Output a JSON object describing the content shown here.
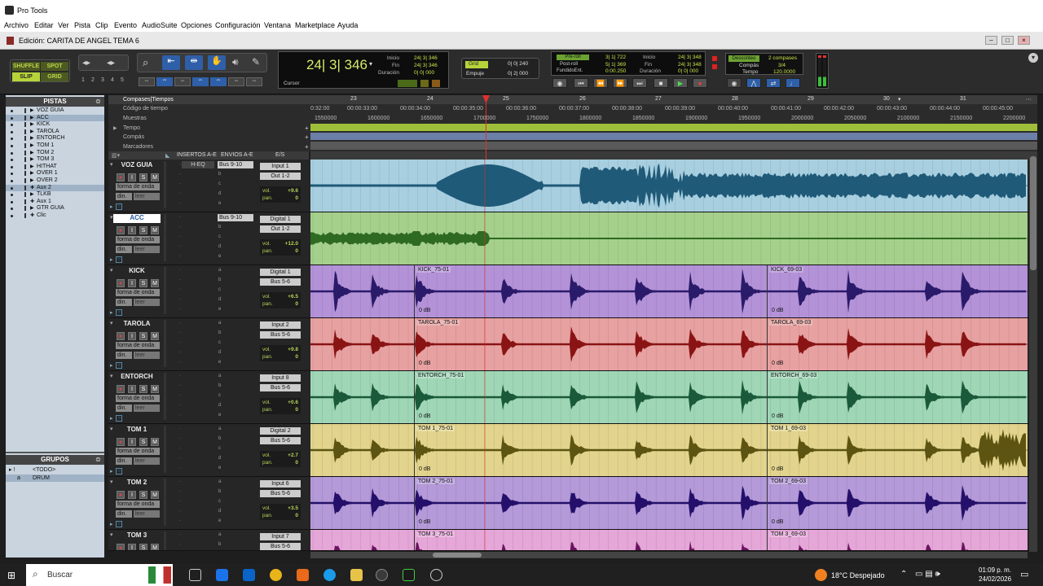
{
  "window": {
    "app_title": "Pro Tools",
    "doc_title": "Edición: CARITA DE ANGEL TEMA 6"
  },
  "menu": [
    "Archivo",
    "Editar",
    "Ver",
    "Pista",
    "Clip",
    "Evento",
    "AudioSuite",
    "Opciones",
    "Configuración",
    "Ventana",
    "Marketplace",
    "Ayuda"
  ],
  "toolbar": {
    "modes": [
      "SHUFFLE",
      "SPOT",
      "SLIP",
      "GRID"
    ],
    "zoom_presets": [
      "1",
      "2",
      "3",
      "4",
      "5"
    ],
    "main_counter": "24| 3| 346",
    "counter_labels": {
      "start": "Inicio",
      "end": "Fin",
      "length": "Duración",
      "cursor": "Cursor"
    },
    "counter_values": {
      "start": "24| 3| 346",
      "end": "24| 3| 346",
      "length": "0| 0| 000"
    },
    "grid_label": "Grid",
    "grid_value": "0| 0| 240",
    "nudge_label": "Empuje",
    "nudge_value": "0| 2| 000",
    "preroll_label": "Pre-roll",
    "postroll_label": "Post-roll",
    "fadein_label": "FundidoEnt.",
    "preroll_value": "3| 1| 722",
    "postroll_value": "5| 1| 369",
    "fadein_value": "0:00.250",
    "t_start_label": "Inicio",
    "t_end_label": "Fin",
    "t_len_label": "Duración",
    "t_start": "24| 3| 348",
    "t_end": "24| 3| 348",
    "t_len": "0| 0| 000",
    "countoff_label": "Desconteo",
    "countoff_value": "2 compases",
    "meter_label": "Compás",
    "meter_value": "3/4",
    "tempo_label": "Tempo",
    "tempo_value": "120.0000"
  },
  "left_panel": {
    "tracks_header": "PISTAS",
    "tracks": [
      "VOZ GUIA",
      "ACC",
      "KICK",
      "TAROLA",
      "ENTORCH",
      "TOM 1",
      "TOM 2",
      "TOM 3",
      "HITHAT",
      "OVER 1",
      "OVER 2",
      "Aux 2",
      "TLKB",
      "Aux 1",
      "GTR GUIA",
      "Clic"
    ],
    "groups_header": "GRUPOS",
    "groups": [
      "<TODO>",
      "DRUM"
    ]
  },
  "ruler": {
    "rows": [
      "Compases|Tiempos",
      "Código de tiempo",
      "Muestras",
      "Tempo",
      "Compás",
      "Marcadores"
    ],
    "bars": [
      "23",
      "24",
      "25",
      "26",
      "27",
      "28",
      "29",
      "30",
      "31"
    ],
    "timecodes": [
      "0:32:00",
      "00:00:33:00",
      "00:00:34:00",
      "00:00:35:00",
      "00:00:36:00",
      "00:00:37:00",
      "00:00:38:00",
      "00:00:39:00",
      "00:00:40:00",
      "00:00:41:00",
      "00:00:42:00",
      "00:00:43:00",
      "00:00:44:00",
      "00:00:45:00"
    ],
    "samples": [
      "1550000",
      "1600000",
      "1650000",
      "1700000",
      "1750000",
      "1800000",
      "1850000",
      "1900000",
      "1950000",
      "2000000",
      "2050000",
      "2100000",
      "2150000",
      "2200000"
    ]
  },
  "columns": {
    "inserts": "INSERTOS A-E",
    "sends": "ENVIOS A-E",
    "io": "E/S"
  },
  "track_labels": {
    "waveform": "forma de onda",
    "dyn": "din.",
    "read": "leer",
    "vol": "vol.",
    "pan": "pan."
  },
  "tracks": [
    {
      "name": "VOZ GUIA",
      "insert": "H-EQ",
      "send": "Bus 9-10",
      "input": "Input 1",
      "output": "Out 1-2",
      "vol": "+9.6",
      "pan": "0",
      "color": "#a8cfe0",
      "wave": "#1f5a78",
      "clips": []
    },
    {
      "name": "ACC",
      "insert": "",
      "send": "Bus 9-10",
      "input": "Digital 1",
      "output": "Out 1-2",
      "vol": "+12.0",
      "pan": "0",
      "color": "#a5d08c",
      "wave": "#2f6a22",
      "clips": []
    },
    {
      "name": "KICK",
      "insert": "",
      "send": "",
      "input": "Digital 1",
      "output": "Bus 5-6",
      "vol": "+6.5",
      "pan": "0",
      "color": "#b492d8",
      "wave": "#2a1a6a",
      "clips": [
        "KICK_75-01",
        "KICK_69-03"
      ]
    },
    {
      "name": "TAROLA",
      "insert": "",
      "send": "",
      "input": "Input 2",
      "output": "Bus 5-6",
      "vol": "+9.8",
      "pan": "0",
      "color": "#e7a1a1",
      "wave": "#8a1414",
      "clips": [
        "TAROLA_75-01",
        "TAROLA_69-03"
      ]
    },
    {
      "name": "ENTORCH",
      "insert": "",
      "send": "",
      "input": "Input 8",
      "output": "Bus 5-6",
      "vol": "+0.6",
      "pan": "0",
      "color": "#9fd6b6",
      "wave": "#1a5a3a",
      "clips": [
        "ENTORCH_75-01",
        "ENTORCH_69-03"
      ]
    },
    {
      "name": "TOM 1",
      "insert": "",
      "send": "",
      "input": "Digital 2",
      "output": "Bus 5-6",
      "vol": "+2.7",
      "pan": "0",
      "color": "#e2d48d",
      "wave": "#5d5412",
      "clips": [
        "TOM 1_75-01",
        "TOM 1_69-03"
      ]
    },
    {
      "name": "TOM 2",
      "insert": "",
      "send": "",
      "input": "Input 6",
      "output": "Bus 5-6",
      "vol": "+3.5",
      "pan": "0",
      "color": "#b49ad8",
      "wave": "#24106a",
      "clips": [
        "TOM 2_75-01",
        "TOM 2_69-03"
      ]
    },
    {
      "name": "TOM 3",
      "insert": "",
      "send": "",
      "input": "Input 7",
      "output": "Bus 5-6",
      "vol": "",
      "pan": "",
      "color": "#e5a6d8",
      "wave": "#6a1460",
      "clips": [
        "TOM 3_75-01",
        "TOM 3_69-03"
      ]
    }
  ],
  "clip_gain": "0 dB",
  "taskbar": {
    "search": "Buscar",
    "weather": "18°C Despejado",
    "time": "01:09 p. m.",
    "date": "24/02/2026"
  }
}
